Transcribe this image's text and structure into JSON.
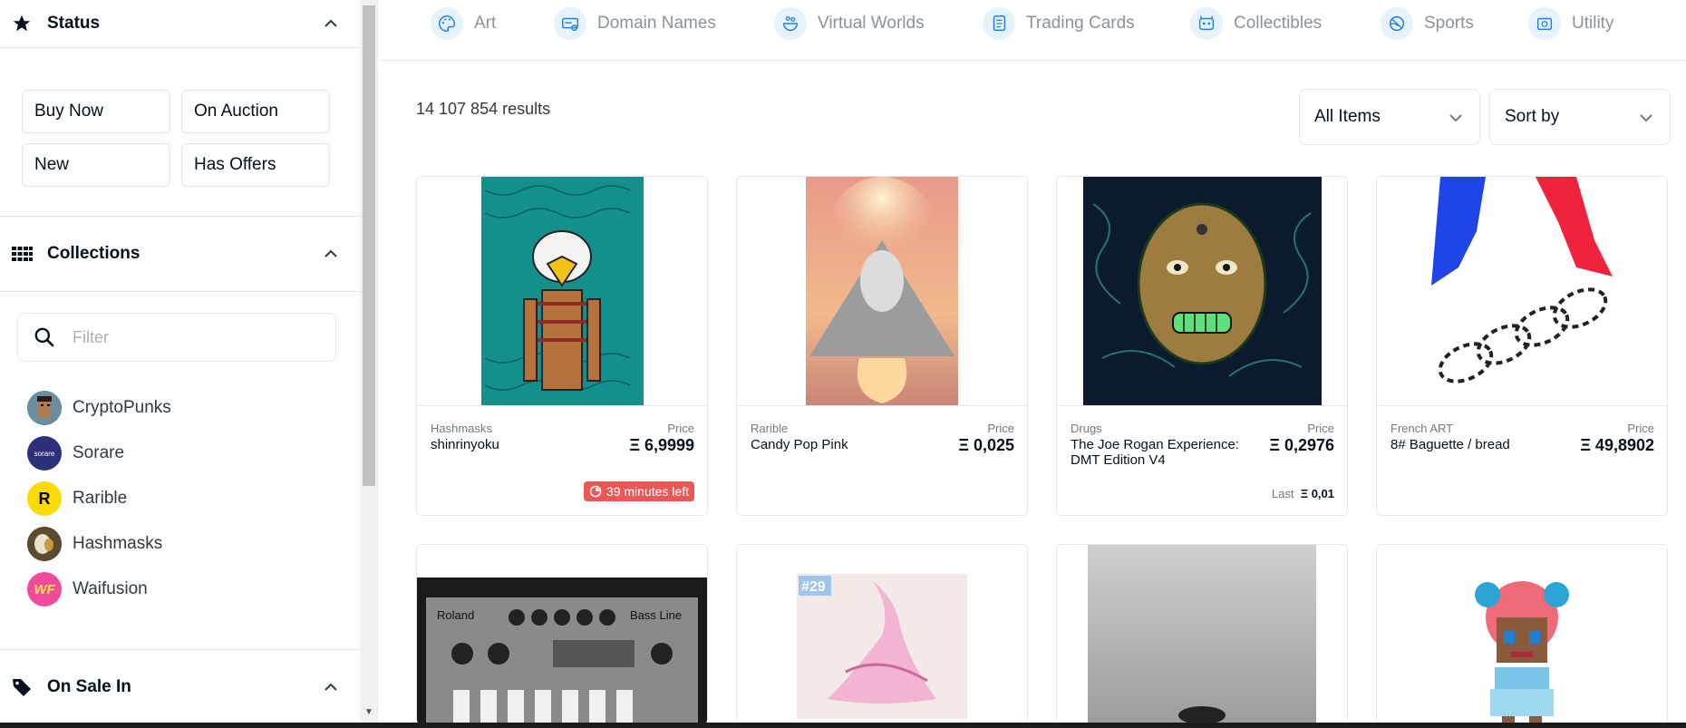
{
  "sidebar": {
    "status": {
      "title": "Status",
      "buttons": [
        "Buy Now",
        "On Auction",
        "New",
        "Has Offers"
      ]
    },
    "collections": {
      "title": "Collections",
      "filter_placeholder": "Filter",
      "items": [
        {
          "name": "CryptoPunks",
          "avatar_text": "",
          "avatar_color": "#6b8e9e"
        },
        {
          "name": "Sorare",
          "avatar_text": "sorare",
          "avatar_color": "#2d2f7a"
        },
        {
          "name": "Rarible",
          "avatar_text": "R",
          "avatar_color": "#feda03"
        },
        {
          "name": "Hashmasks",
          "avatar_text": "",
          "avatar_color": "#8a6d3b"
        },
        {
          "name": "Waifusion",
          "avatar_text": "WF",
          "avatar_color": "#f04a9a"
        }
      ]
    },
    "on_sale": {
      "title": "On Sale In"
    }
  },
  "categories": [
    "Art",
    "Domain Names",
    "Virtual Worlds",
    "Trading Cards",
    "Collectibles",
    "Sports",
    "Utility"
  ],
  "results_text": "14 107 854 results",
  "dropdowns": {
    "items": "All Items",
    "sort": "Sort by"
  },
  "price_label": "Price",
  "eth_symbol": "Ξ",
  "cards": [
    {
      "collection": "Hashmasks",
      "name": "shinrinyoku",
      "price": "Ξ 6,9999",
      "badge": "39 minutes left"
    },
    {
      "collection": "Rarible",
      "name": "Candy Pop Pink",
      "price": "Ξ 0,025"
    },
    {
      "collection": "Drugs",
      "name": "The Joe Rogan Experience: DMT Edition V4",
      "price": "Ξ 0,2976",
      "last_label": "Last",
      "last_value": "Ξ 0,01"
    },
    {
      "collection": "French ART",
      "name": "8# Baguette / bread",
      "price": "Ξ 49,8902"
    }
  ],
  "card_row2_labels": {
    "tag_29": "#29",
    "roland_brand": "Roland",
    "bassline": "Bass Line"
  },
  "colors": {
    "accent": "#2081e2",
    "badge_red": "#eb5757",
    "category_icon_bg": "#e6f3fc"
  }
}
